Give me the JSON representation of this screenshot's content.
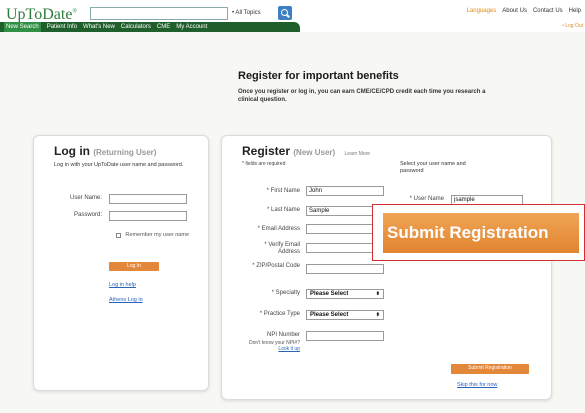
{
  "header": {
    "logo": "UpToDate",
    "logo_mark": "®",
    "search_placeholder": "",
    "topics_select": "• All Topics",
    "links": [
      "Languages",
      "About Us",
      "Contact Us",
      "Help"
    ],
    "logout": "Log Out"
  },
  "nav": {
    "items": [
      "New Search",
      "Patient Info",
      "What's New",
      "Calculators",
      "CME",
      "My Account"
    ]
  },
  "hero": {
    "title": "Register for important benefits",
    "text": "Once you register or log in, you can earn CME/CE/CPD credit each time you research a clinical question."
  },
  "login": {
    "title": "Log in",
    "subtitle": "(Returning User)",
    "description": "Log in with your UpToDate user name and password.",
    "username_label": "User Name:",
    "password_label": "Password:",
    "remember_label": "Remember my user name",
    "button": "Log In",
    "help_link": "Log in help",
    "athens_link": "Athens Log in"
  },
  "register": {
    "title": "Register",
    "subtitle": "(New User)",
    "learn_more": "Learn More",
    "required_note": "* fields are required",
    "select_note": "Select your user name and password",
    "fields": {
      "first_name_label": "* First Name",
      "first_name_value": "John",
      "last_name_label": "* Last Name",
      "last_name_value": "Sample",
      "email_label": "* Email Address",
      "verify_email_label": "* Verify Email Address",
      "zip_label": "* ZIP/Postal Code",
      "specialty_label": "* Specialty",
      "specialty_value": "Please Select",
      "practice_label": "* Practice Type",
      "practice_value": "Please Select",
      "npi_label": "NPI Number",
      "npi_help": "Don't know your NPI#?",
      "npi_lookup": "Look it up",
      "username_label": "* User Name",
      "username_value": "jsample"
    },
    "submit_button": "Submit Registration",
    "skip_link": "Skip this for now"
  },
  "callout": {
    "label": "Submit Registration"
  }
}
